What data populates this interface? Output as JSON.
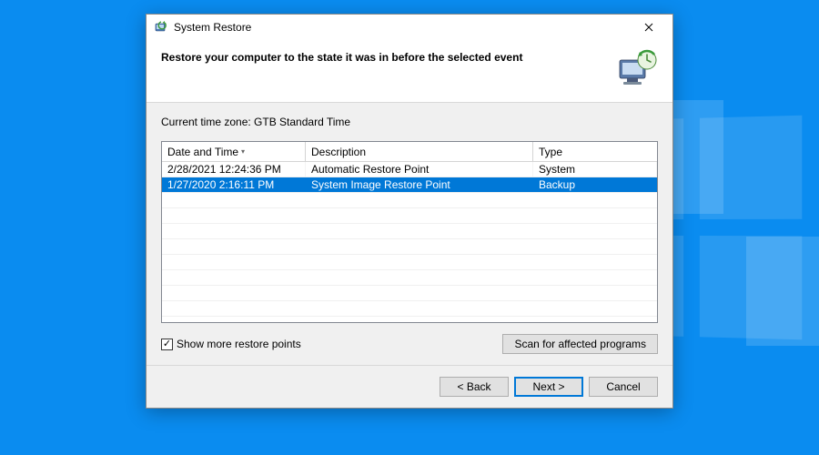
{
  "window": {
    "title": "System Restore"
  },
  "header": {
    "heading": "Restore your computer to the state it was in before the selected event"
  },
  "timezone": {
    "label": "Current time zone: GTB Standard Time"
  },
  "table": {
    "columns": {
      "date": "Date and Time",
      "description": "Description",
      "type": "Type"
    },
    "rows": [
      {
        "date": "2/28/2021 12:24:36 PM",
        "description": "Automatic Restore Point",
        "type": "System",
        "selected": false
      },
      {
        "date": "1/27/2020 2:16:11 PM",
        "description": "System Image Restore Point",
        "type": "Backup",
        "selected": true
      }
    ]
  },
  "options": {
    "show_more_label": "Show more restore points",
    "show_more_checked": true,
    "scan_label": "Scan for affected programs"
  },
  "footer": {
    "back": "< Back",
    "next": "Next >",
    "cancel": "Cancel"
  }
}
